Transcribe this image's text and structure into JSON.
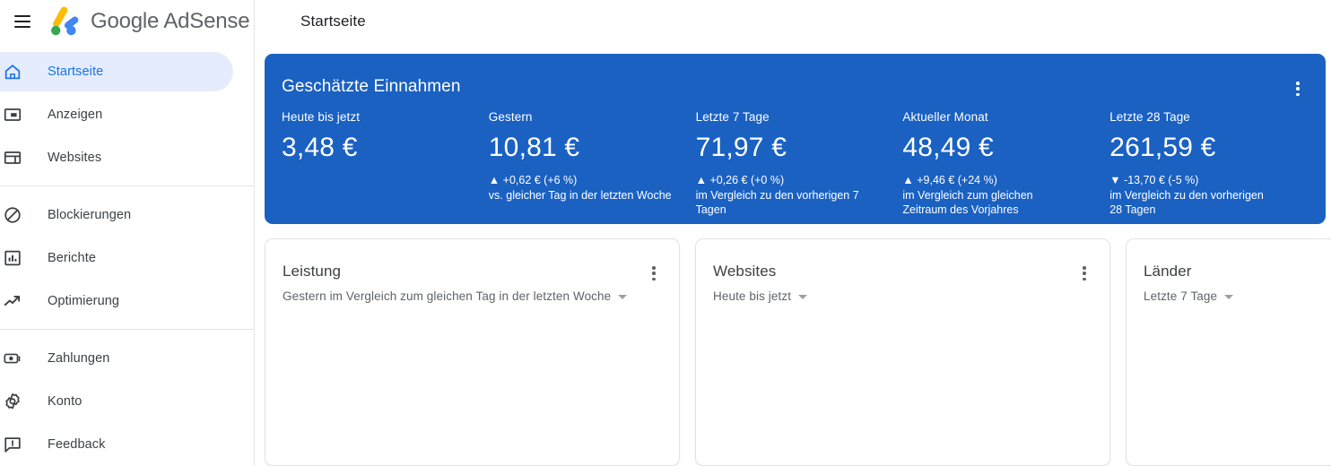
{
  "topbar": {
    "menu_icon": "hamburger-icon",
    "logo_text": "Google AdSense",
    "page_title": "Startseite"
  },
  "sidebar": {
    "groups": [
      {
        "items": [
          {
            "label": "Startseite",
            "icon": "home-icon",
            "active": true
          },
          {
            "label": "Anzeigen",
            "icon": "ads-icon",
            "active": false
          },
          {
            "label": "Websites",
            "icon": "sites-icon",
            "active": false
          }
        ]
      },
      {
        "items": [
          {
            "label": "Blockierungen",
            "icon": "block-icon",
            "active": false
          },
          {
            "label": "Berichte",
            "icon": "reports-icon",
            "active": false
          },
          {
            "label": "Optimierung",
            "icon": "optimization-icon",
            "active": false
          }
        ]
      },
      {
        "items": [
          {
            "label": "Zahlungen",
            "icon": "payments-icon",
            "active": false
          },
          {
            "label": "Konto",
            "icon": "gear-icon",
            "active": false
          },
          {
            "label": "Feedback",
            "icon": "feedback-icon",
            "active": false
          }
        ]
      }
    ]
  },
  "earnings_card": {
    "title": "Geschätzte Einnahmen",
    "accent_color": "#1a61c2",
    "menu_icon": "more-vert-icon",
    "metrics": [
      {
        "label": "Heute bis jetzt",
        "value": "3,48 €",
        "delta": "",
        "sub": ""
      },
      {
        "label": "Gestern",
        "value": "10,81 €",
        "delta": "▲ +0,62 € (+6 %)",
        "sub": "vs. gleicher Tag in der letzten Woche"
      },
      {
        "label": "Letzte 7 Tage",
        "value": "71,97 €",
        "delta": "▲ +0,26 € (+0 %)",
        "sub": "im Vergleich zu den vorherigen 7 Tagen"
      },
      {
        "label": "Aktueller Monat",
        "value": "48,49 €",
        "delta": "▲ +9,46 € (+24 %)",
        "sub": "im Vergleich zum gleichen Zeitraum des Vorjahres"
      },
      {
        "label": "Letzte 28 Tage",
        "value": "261,59 €",
        "delta": "▼ -13,70 € (-5 %)",
        "sub": "im Vergleich zu den vorherigen 28 Tagen"
      }
    ]
  },
  "panels": [
    {
      "title": "Leistung",
      "range": "Gestern im Vergleich zum gleichen Tag in der letzten Woche",
      "menu_icon": "more-vert-icon"
    },
    {
      "title": "Websites",
      "range": "Heute bis jetzt",
      "menu_icon": "more-vert-icon"
    },
    {
      "title": "Länder",
      "range": "Letzte 7 Tage",
      "menu_icon": "more-vert-icon"
    }
  ]
}
